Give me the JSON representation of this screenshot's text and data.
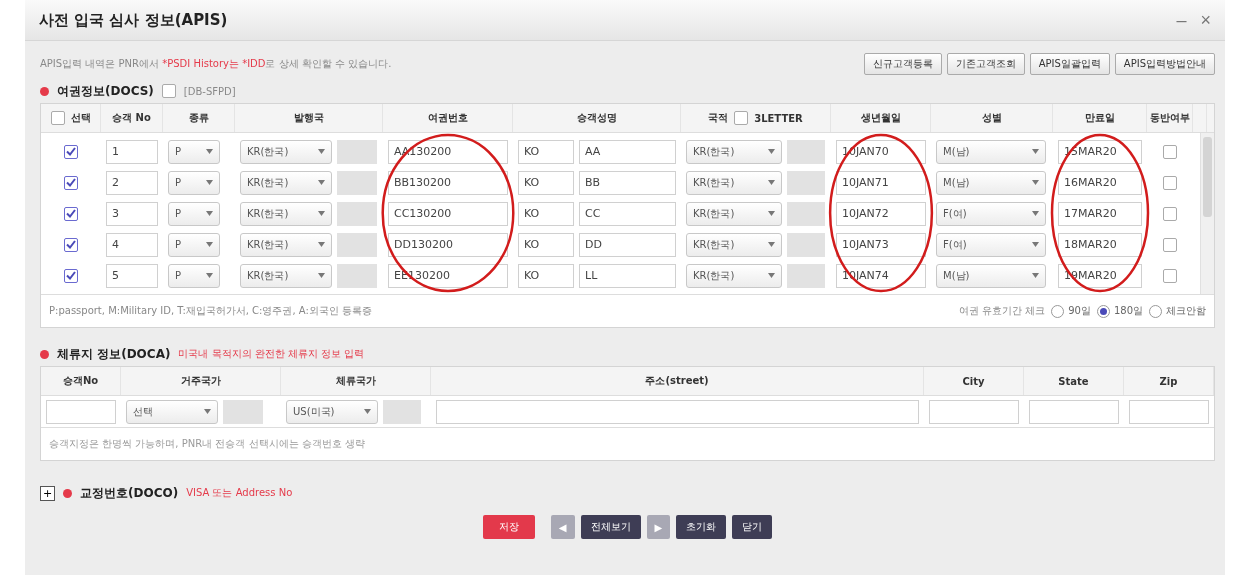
{
  "window": {
    "title": "사전 입국 심사 정보(APIS)",
    "minimize": "–",
    "close": "×"
  },
  "notice": {
    "before": "APIS입력 내역은 PNR에서 ",
    "highlight": "*PSDI History는 *IDD",
    "after": "로 상세 확인할 수 있습니다."
  },
  "toolbar_buttons": [
    "신규고객등록",
    "기존고객조회",
    "APIS일괄입력",
    "APIS입력방법안내"
  ],
  "docs": {
    "title": "여권정보(DOCS)",
    "option": {
      "label": "[DB-SFPD]",
      "checked": false
    },
    "select_all": {
      "checked": false
    },
    "letter_option": {
      "label": "3LETTER",
      "checked": false
    },
    "columns": [
      {
        "label": "선택",
        "circled": false
      },
      {
        "label": "승객 No",
        "circled": false
      },
      {
        "label": "종류",
        "circled": false
      },
      {
        "label": "발행국",
        "circled": false
      },
      {
        "label": "여권번호",
        "circled": true
      },
      {
        "label": "승객성명",
        "circled": false
      },
      {
        "label": "국적",
        "circled": false
      },
      {
        "label": "생년월일",
        "circled": true
      },
      {
        "label": "성별",
        "circled": false
      },
      {
        "label": "만료일",
        "circled": true
      },
      {
        "label": "동반여부",
        "circled": false
      }
    ],
    "rows": [
      {
        "checked": true,
        "no": "1",
        "type": "P",
        "issuer": "KR(한국)",
        "passport": "AA130200",
        "surname": "KO",
        "given": "AA",
        "nationality": "KR(한국)",
        "birth": "10JAN70",
        "gender": "M(남)",
        "expiry": "15MAR20",
        "companion": false
      },
      {
        "checked": true,
        "no": "2",
        "type": "P",
        "issuer": "KR(한국)",
        "passport": "BB130200",
        "surname": "KO",
        "given": "BB",
        "nationality": "KR(한국)",
        "birth": "10JAN71",
        "gender": "M(남)",
        "expiry": "16MAR20",
        "companion": false
      },
      {
        "checked": true,
        "no": "3",
        "type": "P",
        "issuer": "KR(한국)",
        "passport": "CC130200",
        "surname": "KO",
        "given": "CC",
        "nationality": "KR(한국)",
        "birth": "10JAN72",
        "gender": "F(여)",
        "expiry": "17MAR20",
        "companion": false
      },
      {
        "checked": true,
        "no": "4",
        "type": "P",
        "issuer": "KR(한국)",
        "passport": "DD130200",
        "surname": "KO",
        "given": "DD",
        "nationality": "KR(한국)",
        "birth": "10JAN73",
        "gender": "F(여)",
        "expiry": "18MAR20",
        "companion": false
      },
      {
        "checked": true,
        "no": "5",
        "type": "P",
        "issuer": "KR(한국)",
        "passport": "EE130200",
        "surname": "KO",
        "given": "LL",
        "nationality": "KR(한국)",
        "birth": "10JAN74",
        "gender": "M(남)",
        "expiry": "19MAR20",
        "companion": false
      }
    ],
    "legend": "P:passport, M:Military ID, T:재입국허가서, C:영주권, A:외국인 등록증",
    "validity": {
      "label": "여권 유효기간 체크",
      "options": [
        {
          "label": "90일",
          "selected": false
        },
        {
          "label": "180일",
          "selected": true
        },
        {
          "label": "체크안함",
          "selected": false
        }
      ]
    }
  },
  "doca": {
    "title": "체류지 정보(DOCA)",
    "hint": "미국내 목적지의 완전한 체류지 정보 입력",
    "columns": [
      "승객No",
      "거주국가",
      "체류국가",
      "주소(street)",
      "City",
      "State",
      "Zip"
    ],
    "row": {
      "residence": "선택",
      "stay": "US(미국)"
    },
    "note": "승객지정은 한명씩 가능하며, PNR내 전승객 선택시에는 승객번호 생략"
  },
  "doco": {
    "expanded": false,
    "toggle": "+",
    "title": "교정번호(DOCO)",
    "hint": "VISA 또는 Address No"
  },
  "buttons": [
    {
      "label": "저장",
      "kind": "primary"
    },
    {
      "label": "◀",
      "kind": "nav"
    },
    {
      "label": "전체보기",
      "kind": "dark"
    },
    {
      "label": "▶",
      "kind": "nav"
    },
    {
      "label": "초기화",
      "kind": "dark"
    },
    {
      "label": "닫기",
      "kind": "dark"
    }
  ]
}
